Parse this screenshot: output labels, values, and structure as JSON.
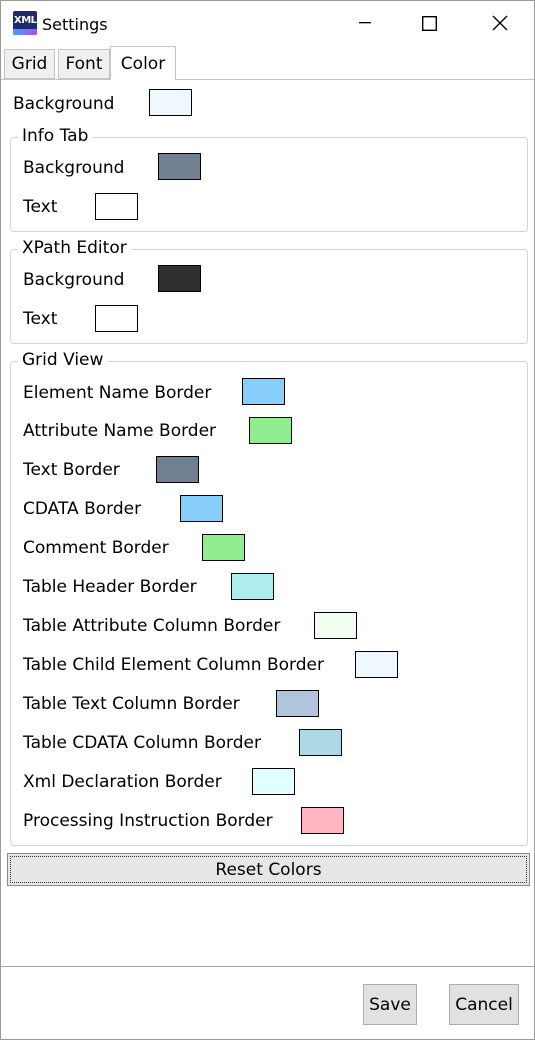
{
  "window": {
    "title": "Settings",
    "icon_text": "XML"
  },
  "tabs": [
    {
      "label": "Grid"
    },
    {
      "label": "Font"
    },
    {
      "label": "Color",
      "active": true
    }
  ],
  "background": {
    "label": "Background",
    "color": "#F0F8FF"
  },
  "info_tab": {
    "legend": "Info Tab",
    "background": {
      "label": "Background",
      "color": "#708090"
    },
    "text": {
      "label": "Text",
      "color": "#FFFFFF"
    }
  },
  "xpath_editor": {
    "legend": "XPath Editor",
    "background": {
      "label": "Background",
      "color": "#2F2F2F"
    },
    "text": {
      "label": "Text",
      "color": "#FFFFFF"
    }
  },
  "grid_view": {
    "legend": "Grid View",
    "items": [
      {
        "label": "Element Name Border",
        "color": "#87CEFA"
      },
      {
        "label": "Attribute Name Border",
        "color": "#90EE90"
      },
      {
        "label": "Text Border",
        "color": "#708090"
      },
      {
        "label": "CDATA Border",
        "color": "#87CEFA"
      },
      {
        "label": "Comment Border",
        "color": "#90EE90"
      },
      {
        "label": "Table Header Border",
        "color": "#AFEEEE"
      },
      {
        "label": "Table Attribute Column Border",
        "color": "#F0FFF0"
      },
      {
        "label": "Table Child Element Column Border",
        "color": "#F0F8FF"
      },
      {
        "label": "Table Text Column Border",
        "color": "#B0C4DE"
      },
      {
        "label": "Table CDATA Column Border",
        "color": "#ADD8E6"
      },
      {
        "label": "Xml Declaration Border",
        "color": "#E0FFFF"
      },
      {
        "label": "Processing Instruction Border",
        "color": "#FFB6C1"
      }
    ]
  },
  "reset_button": {
    "label": "Reset Colors"
  },
  "footer": {
    "save_label": "Save",
    "cancel_label": "Cancel"
  }
}
